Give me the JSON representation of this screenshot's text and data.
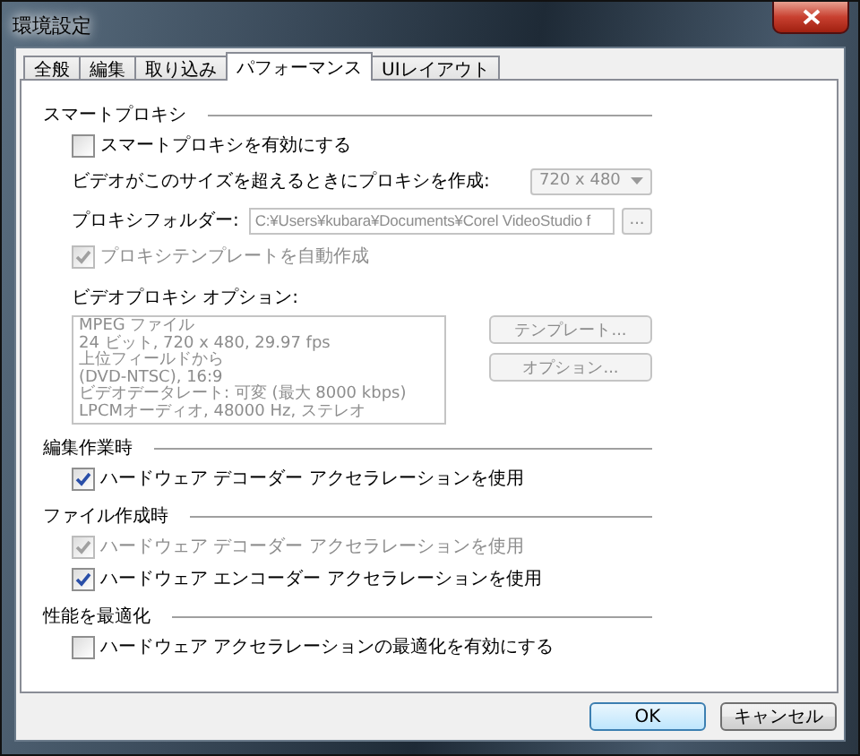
{
  "window": {
    "title": "環境設定"
  },
  "tabs": [
    {
      "label": "全般",
      "selected": false
    },
    {
      "label": "編集",
      "selected": false
    },
    {
      "label": "取り込み",
      "selected": false
    },
    {
      "label": "パフォーマンス",
      "selected": true
    },
    {
      "label": "UIレイアウト",
      "selected": false
    }
  ],
  "sections": [
    {
      "heading": "スマートプロキシ",
      "items": [
        {
          "kind": "checkbox",
          "label": "スマートプロキシを有効にする",
          "checked": false,
          "disabled": false
        },
        {
          "kind": "select",
          "label": "ビデオがこのサイズを超えるときにプロキシを作成:",
          "value": "720 x 480",
          "disabled": true
        },
        {
          "kind": "folder",
          "label": "プロキシフォルダー:",
          "value": "C:¥Users¥kubara¥Documents¥Corel VideoStudio f",
          "button": "...",
          "disabled": true
        },
        {
          "kind": "checkbox",
          "label": "プロキシテンプレートを自動作成",
          "checked": true,
          "disabled": true
        },
        {
          "kind": "options",
          "label": "ビデオプロキシ オプション:",
          "lines": [
            "MPEG ファイル",
            "24 ビット, 720 x 480, 29.97 fps",
            "上位フィールドから",
            "(DVD-NTSC),  16:9",
            "ビデオデータレート: 可変 (最大  8000 kbps)",
            "LPCMオーディオ, 48000 Hz, ステレオ"
          ],
          "buttons": [
            {
              "label": "テンプレート...",
              "disabled": true
            },
            {
              "label": "オプション...",
              "disabled": true
            }
          ]
        }
      ]
    },
    {
      "heading": "編集作業時",
      "items": [
        {
          "kind": "checkbox",
          "label": "ハードウェア デコーダー アクセラレーションを使用",
          "checked": true,
          "disabled": false
        }
      ]
    },
    {
      "heading": "ファイル作成時",
      "items": [
        {
          "kind": "checkbox",
          "label": "ハードウェア デコーダー アクセラレーションを使用",
          "checked": true,
          "disabled": true
        },
        {
          "kind": "checkbox",
          "label": "ハードウェア エンコーダー アクセラレーションを使用",
          "checked": true,
          "disabled": false
        }
      ]
    },
    {
      "heading": "性能を最適化",
      "items": [
        {
          "kind": "checkbox",
          "label": "ハードウェア アクセラレーションの最適化を有効にする",
          "checked": false,
          "disabled": false
        }
      ]
    }
  ],
  "buttons": [
    {
      "label": "OK",
      "default": true
    },
    {
      "label": "キャンセル",
      "default": false
    }
  ]
}
